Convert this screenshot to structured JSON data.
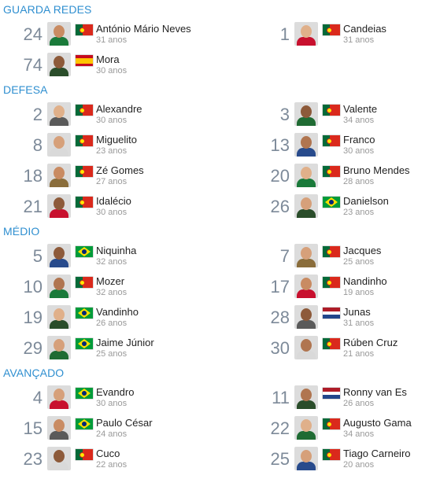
{
  "sections": [
    {
      "id": "gk",
      "title": "GUARDA REDES",
      "players": [
        {
          "number": "24",
          "name": "António Mário Neves",
          "age": "31 anos",
          "flag": "portugal-flag"
        },
        {
          "number": "1",
          "name": "Candeias",
          "age": "31 anos",
          "flag": "portugal-flag"
        },
        {
          "number": "74",
          "name": "Mora",
          "age": "30 anos",
          "flag": "spain-flag"
        }
      ]
    },
    {
      "id": "df",
      "title": "DEFESA",
      "players": [
        {
          "number": "2",
          "name": "Alexandre",
          "age": "30 anos",
          "flag": "portugal-flag"
        },
        {
          "number": "3",
          "name": "Valente",
          "age": "34 anos",
          "flag": "portugal-flag"
        },
        {
          "number": "8",
          "name": "Miguelito",
          "age": "23 anos",
          "flag": "portugal-flag"
        },
        {
          "number": "13",
          "name": "Franco",
          "age": "30 anos",
          "flag": "portugal-flag"
        },
        {
          "number": "18",
          "name": "Zé Gomes",
          "age": "27 anos",
          "flag": "portugal-flag"
        },
        {
          "number": "20",
          "name": "Bruno Mendes",
          "age": "28 anos",
          "flag": "portugal-flag"
        },
        {
          "number": "21",
          "name": "Idalécio",
          "age": "30 anos",
          "flag": "portugal-flag"
        },
        {
          "number": "26",
          "name": "Danielson",
          "age": "23 anos",
          "flag": "brazil-flag"
        }
      ]
    },
    {
      "id": "mf",
      "title": "MÉDIO",
      "players": [
        {
          "number": "5",
          "name": "Niquinha",
          "age": "32 anos",
          "flag": "brazil-flag"
        },
        {
          "number": "7",
          "name": "Jacques",
          "age": "25 anos",
          "flag": "portugal-flag"
        },
        {
          "number": "10",
          "name": "Mozer",
          "age": "32 anos",
          "flag": "portugal-flag"
        },
        {
          "number": "17",
          "name": "Nandinho",
          "age": "19 anos",
          "flag": "portugal-flag"
        },
        {
          "number": "19",
          "name": "Vandinho",
          "age": "26 anos",
          "flag": "brazil-flag"
        },
        {
          "number": "28",
          "name": "Junas",
          "age": "31 anos",
          "flag": "netherlands-flag"
        },
        {
          "number": "29",
          "name": "Jaime Júnior",
          "age": "25 anos",
          "flag": "brazil-flag"
        },
        {
          "number": "30",
          "name": "Rúben Cruz",
          "age": "21 anos",
          "flag": "portugal-flag"
        }
      ]
    },
    {
      "id": "fw",
      "title": "AVANÇADO",
      "players": [
        {
          "number": "4",
          "name": "Evandro",
          "age": "30 anos",
          "flag": "brazil-flag"
        },
        {
          "number": "11",
          "name": "Ronny van Es",
          "age": "26 anos",
          "flag": "netherlands-flag"
        },
        {
          "number": "15",
          "name": "Paulo César",
          "age": "24 anos",
          "flag": "brazil-flag"
        },
        {
          "number": "22",
          "name": "Augusto Gama",
          "age": "34 anos",
          "flag": "portugal-flag"
        },
        {
          "number": "23",
          "name": "Cuco",
          "age": "22 anos",
          "flag": "portugal-flag"
        },
        {
          "number": "25",
          "name": "Tiago Carneiro",
          "age": "20 anos",
          "flag": "portugal-flag"
        }
      ]
    }
  ],
  "colors": {
    "section_title": "#2f8fd0",
    "number": "#7d8a99",
    "name": "#222222",
    "age": "#999999"
  }
}
